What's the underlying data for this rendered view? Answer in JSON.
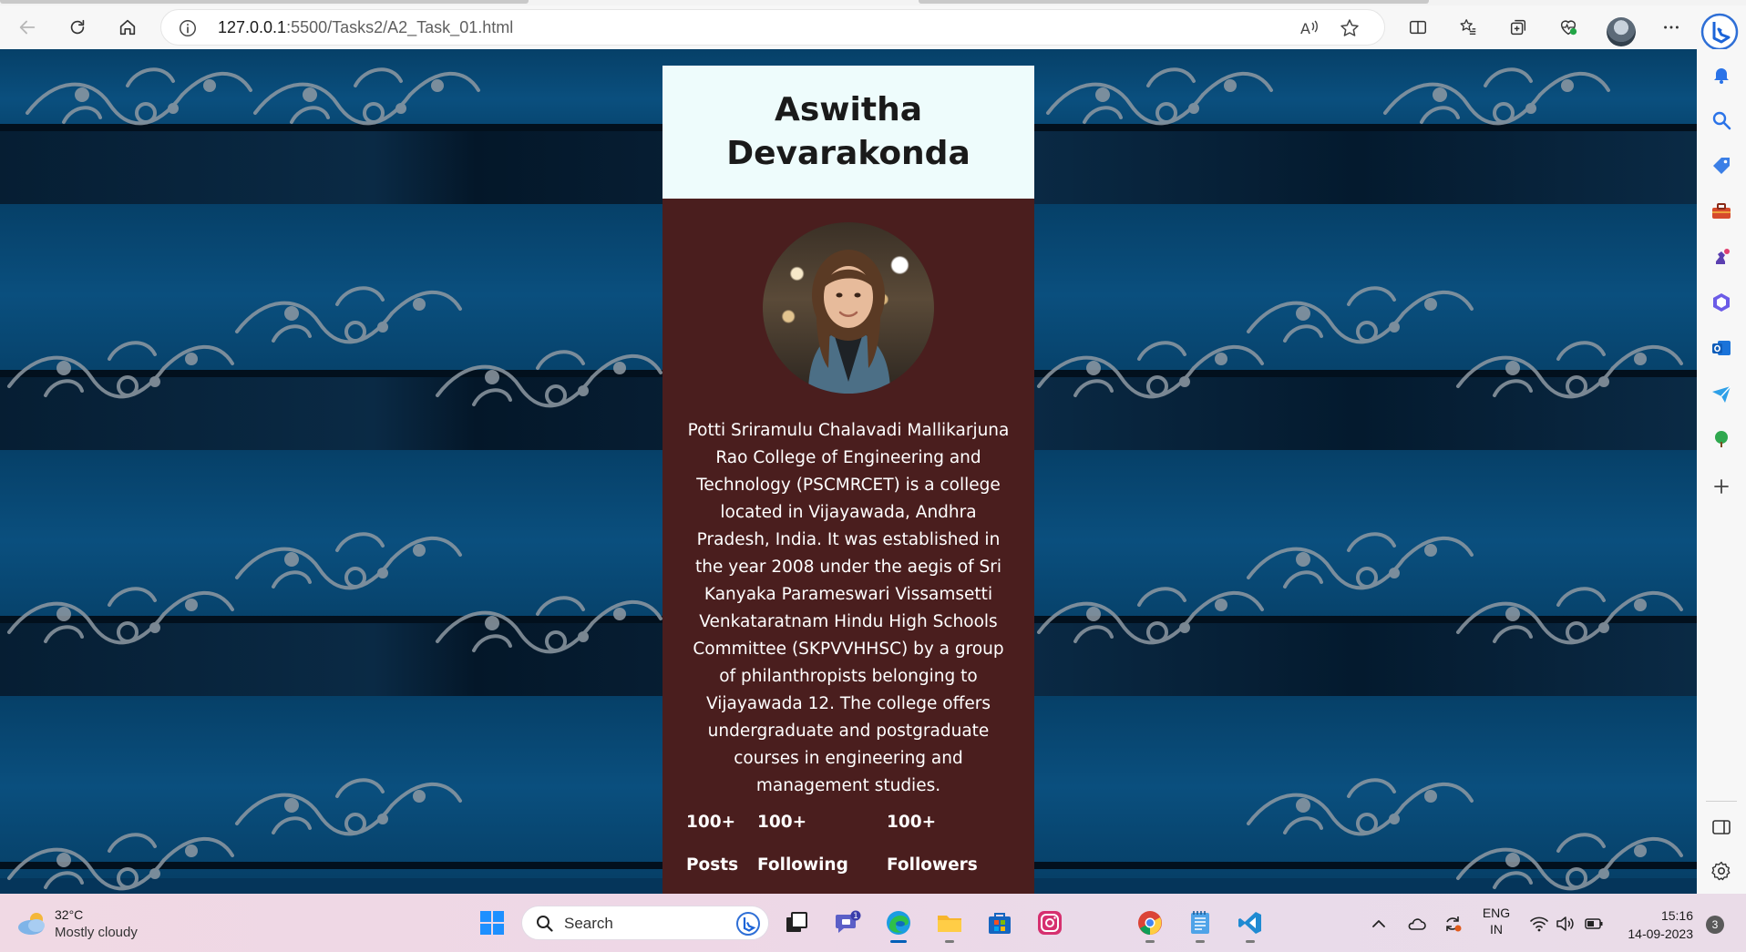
{
  "browser": {
    "url_host": "127.0.0.1",
    "url_path": ":5500/Tasks2/A2_Task_01.html"
  },
  "profile": {
    "name": "Aswitha Devarakonda",
    "bio": "Potti Sriramulu Chalavadi Mallikarjuna Rao College of Engineering and Technology (PSCMRCET) is a college located in Vijayawada, Andhra Pradesh, India. It was established in the year 2008 under the aegis of Sri Kanyaka Parameswari Vissamsetti Venkataratnam Hindu High Schools Committee (SKPVVHHSC) by a group of philanthropists belonging to Vijayawada 12. The college offers undergraduate and postgraduate courses in engineering and management studies.",
    "stats": [
      {
        "value": "100+",
        "label": "Posts"
      },
      {
        "value": "100+",
        "label": "Following"
      },
      {
        "value": "100+",
        "label": "Followers"
      }
    ]
  },
  "colors": {
    "header_bg": "#eefcfc",
    "card_bg": "#4a1e1e",
    "page_bg": "#05355a"
  },
  "taskbar": {
    "weather_temp": "32°C",
    "weather_condition": "Mostly cloudy",
    "search_placeholder": "Search",
    "language_line1": "ENG",
    "language_line2": "IN",
    "time": "15:16",
    "date": "14-09-2023",
    "notification_count": "3",
    "teams_badge": "1"
  }
}
